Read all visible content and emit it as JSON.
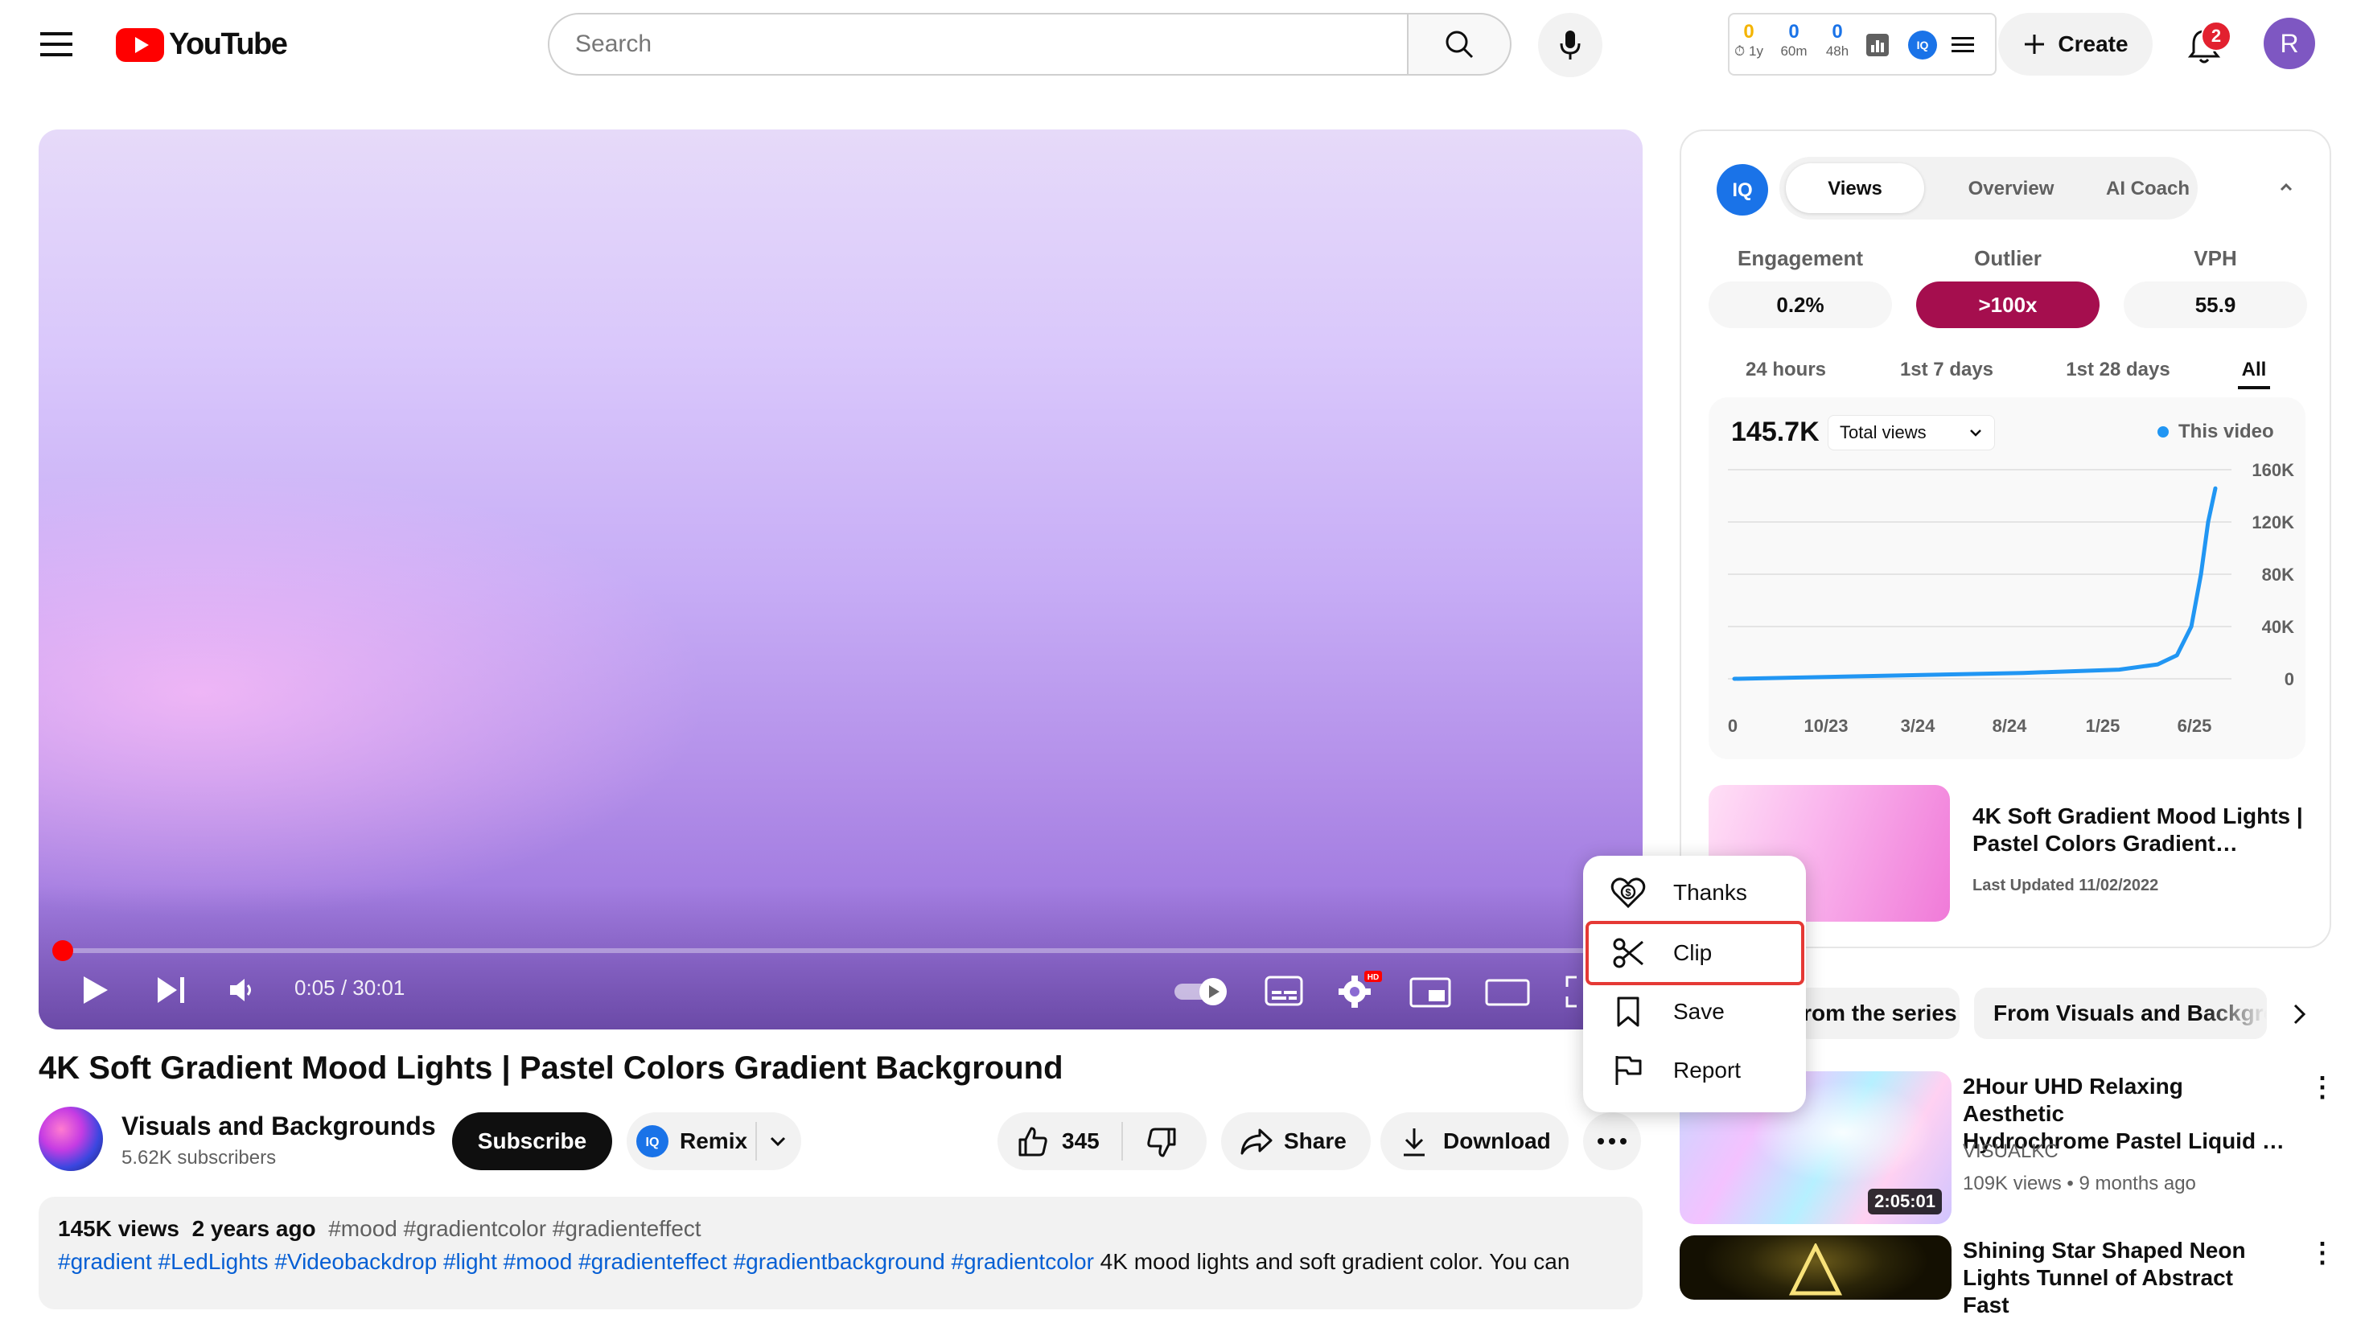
{
  "header": {
    "logo_text": "YouTube",
    "search_placeholder": "Search",
    "create_label": "Create",
    "notification_count": "2",
    "avatar_letter": "R",
    "extension_stats": [
      {
        "value": "0",
        "label": "1y",
        "color": "#f4b400"
      },
      {
        "value": "0",
        "label": "60m",
        "color": "#1a73e8"
      },
      {
        "value": "0",
        "label": "48h",
        "color": "#1a73e8"
      }
    ]
  },
  "player": {
    "time": "0:05 / 30:01",
    "progress": 0.003
  },
  "video": {
    "title": "4K Soft Gradient Mood Lights | Pastel Colors Gradient Background",
    "channel_name": "Visuals and Backgrounds",
    "subscribers": "5.62K subscribers",
    "subscribe_label": "Subscribe",
    "remix_label": "Remix",
    "likes": "345",
    "share_label": "Share",
    "download_label": "Download",
    "views": "145K views",
    "age": "2 years ago",
    "desc_tags_line1": "#mood #gradientcolor #gradienteffect",
    "desc_tags_line2": "#gradient #LedLights #Videobackdrop #light #mood #gradienteffect #gradientbackground #gradientcolor",
    "desc_text": " 4K mood lights and soft gradient color. You can"
  },
  "menu": {
    "items": [
      {
        "label": "Thanks",
        "icon": "thanks-icon"
      },
      {
        "label": "Clip",
        "icon": "scissors-icon"
      },
      {
        "label": "Save",
        "icon": "bookmark-icon"
      },
      {
        "label": "Report",
        "icon": "flag-icon"
      }
    ],
    "highlighted": "Clip"
  },
  "panel": {
    "tabs": [
      "Views",
      "Overview",
      "AI Coach"
    ],
    "active_tab": "Views",
    "metrics": [
      {
        "label": "Engagement",
        "value": "0.2%"
      },
      {
        "label": "Outlier",
        "value": ">100x"
      },
      {
        "label": "VPH",
        "value": "55.9"
      }
    ],
    "ranges": [
      "24 hours",
      "1st 7 days",
      "1st 28 days",
      "All"
    ],
    "active_range": "All",
    "total": "145.7K",
    "select_value": "Total views",
    "legend": "This video",
    "preview_title": "4K Soft Gradient Mood Lights | Pastel Colors Gradient…",
    "preview_date": "Last Updated 11/02/2022"
  },
  "chart_data": {
    "type": "line",
    "x": [
      "0",
      "10/23",
      "3/24",
      "8/24",
      "1/25",
      "6/25"
    ],
    "y_ticks": [
      "160K",
      "120K",
      "80K",
      "40K",
      "0"
    ],
    "ylim": [
      0,
      160000
    ],
    "series": [
      {
        "name": "This video",
        "color": "#2196f3",
        "points": [
          [
            0,
            0
          ],
          [
            0.2,
            1500
          ],
          [
            0.4,
            3000
          ],
          [
            0.6,
            4500
          ],
          [
            0.8,
            7000
          ],
          [
            0.88,
            11000
          ],
          [
            0.92,
            18000
          ],
          [
            0.95,
            40000
          ],
          [
            0.97,
            80000
          ],
          [
            0.985,
            120000
          ],
          [
            1.0,
            145700
          ]
        ]
      }
    ]
  },
  "chips": [
    "From the series",
    "From Visuals and Backgrounds"
  ],
  "recommended": [
    {
      "title_line1": "2Hour UHD Relaxing Aesthetic",
      "title_line2": "Hydrochrome  Pastel Liquid  …",
      "channel": "VISUALKC",
      "meta": "109K views • 9 months ago",
      "duration": "2:05:01"
    },
    {
      "title_line1": "Shining Star Shaped Neon",
      "title_line2": "Lights Tunnel of Abstract Fast"
    }
  ]
}
